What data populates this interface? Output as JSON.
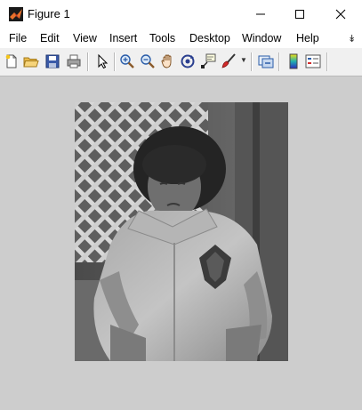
{
  "window": {
    "title": "Figure 1"
  },
  "window_controls": [
    "minimize",
    "maximize",
    "close"
  ],
  "menu": {
    "items": [
      {
        "label": "File"
      },
      {
        "label": "Edit"
      },
      {
        "label": "View"
      },
      {
        "label": "Insert"
      },
      {
        "label": "Tools"
      },
      {
        "label": "Desktop"
      },
      {
        "label": "Window"
      },
      {
        "label": "Help"
      }
    ],
    "overflow_icon": "chevron-double-down-icon"
  },
  "toolbar": {
    "icons": [
      "new-figure-icon",
      "open-file-icon",
      "save-figure-icon",
      "print-figure-icon",
      "edit-plot-pointer-icon",
      "zoom-in-icon",
      "zoom-out-icon",
      "pan-hand-icon",
      "rotate-3d-icon",
      "data-cursor-icon",
      "brush-icon",
      "brush-dropdown-icon",
      "link-plot-icon",
      "insert-colorbar-icon",
      "insert-legend-icon"
    ]
  },
  "figure": {
    "background": "#cdcdcd",
    "image_description_icon": "grayscale-photo"
  }
}
